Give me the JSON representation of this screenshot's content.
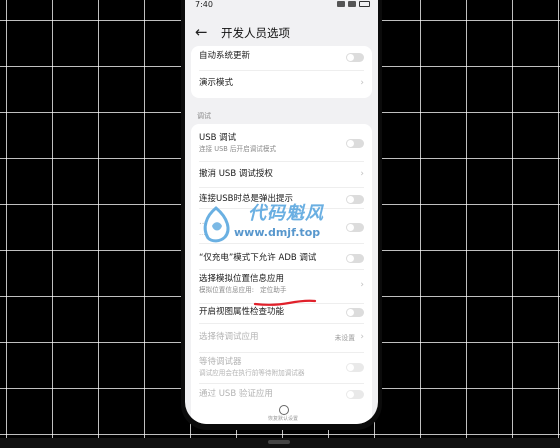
{
  "status": {
    "time": "7:40"
  },
  "header": {
    "back_icon": "arrow-left-icon",
    "title": "开发人员选项"
  },
  "top_card": {
    "auto_update": {
      "label": "自动系统更新"
    },
    "demo_mode": {
      "label": "演示模式"
    }
  },
  "section_debug": "调试",
  "debug": {
    "usb_debug": {
      "label": "USB 调试",
      "sub": "连接 USB 后开启调试模式"
    },
    "revoke_auth": {
      "label": "撤消 USB 调试授权"
    },
    "usb_prompt": {
      "label": "连接USB时总是弹出提示"
    },
    "adb_install": {
      "label": "...",
      "sub": "..."
    },
    "adb_charging": {
      "label": "“仅充电”模式下允许 ADB 调试"
    },
    "mock_location": {
      "label": "选择模拟位置信息应用",
      "sub_prefix": "模拟位置信息应用:",
      "sub_value": "定位助手"
    },
    "view_attr": {
      "label": "开启视图属性检查功能"
    },
    "debug_app": {
      "label": "选择待调试应用",
      "value": "未设置"
    },
    "wait_debugger": {
      "label": "等待调试器",
      "sub": "调试应用会在执行前等待附加调试器"
    },
    "verify_usb": {
      "label": "通过 USB 验证应用"
    }
  },
  "bottom": {
    "text": "恢复默认设置"
  },
  "watermark": {
    "cn": "代码魁风",
    "url": "www.dmjf.top"
  },
  "colors": {
    "screen_bg": "#f1f1f3",
    "card_bg": "#ffffff",
    "toggle_off": "#dcdcdc",
    "annotation": "#e0212b",
    "watermark": "#5aa7df"
  }
}
